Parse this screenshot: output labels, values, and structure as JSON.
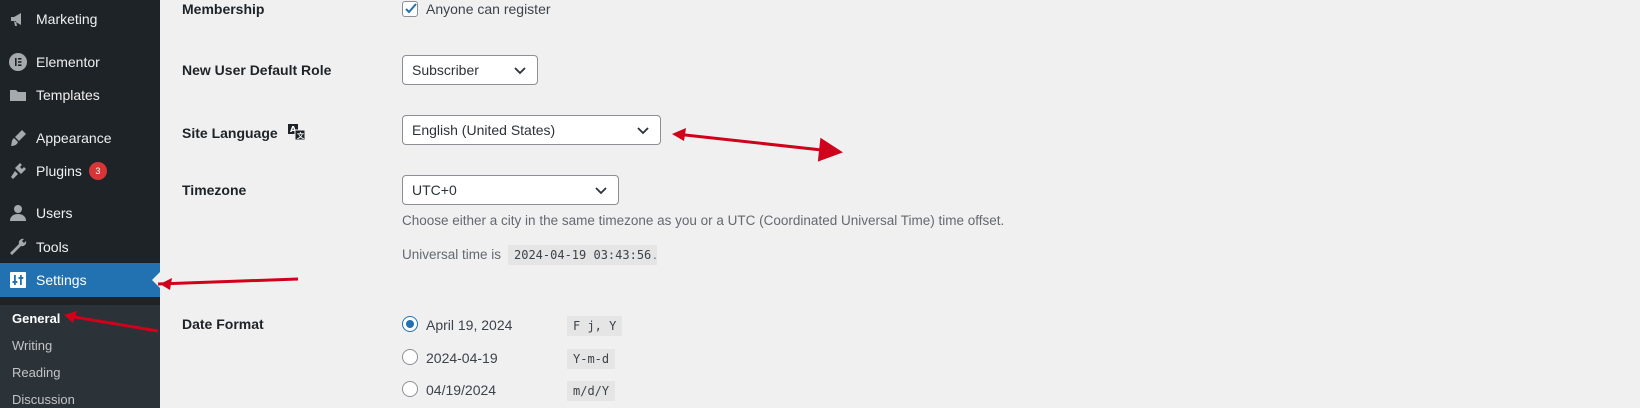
{
  "sidebar": {
    "items": [
      {
        "label": "Marketing",
        "icon": "megaphone-icon"
      },
      {
        "label": "Elementor",
        "icon": "elementor-icon"
      },
      {
        "label": "Templates",
        "icon": "folder-icon"
      },
      {
        "label": "Appearance",
        "icon": "brush-icon"
      },
      {
        "label": "Plugins",
        "icon": "plug-icon",
        "badge": "3"
      },
      {
        "label": "Users",
        "icon": "user-icon"
      },
      {
        "label": "Tools",
        "icon": "wrench-icon"
      },
      {
        "label": "Settings",
        "icon": "sliders-icon",
        "active": true
      }
    ],
    "submenu": [
      "General",
      "Writing",
      "Reading",
      "Discussion"
    ]
  },
  "settings": {
    "membership": {
      "label": "Membership",
      "checkbox_label": "Anyone can register",
      "checked": true
    },
    "default_role": {
      "label": "New User Default Role",
      "value": "Subscriber"
    },
    "site_language": {
      "label": "Site Language",
      "value": "English (United States)"
    },
    "timezone": {
      "label": "Timezone",
      "value": "UTC+0",
      "description": "Choose either a city in the same timezone as you or a UTC (Coordinated Universal Time) time offset.",
      "universal_prefix": "Universal time is",
      "universal_value": "2024-04-19 03:43:56",
      "universal_suffix": "."
    },
    "date_format": {
      "label": "Date Format",
      "options": [
        {
          "display": "April 19, 2024",
          "code": "F j, Y",
          "checked": true
        },
        {
          "display": "2024-04-19",
          "code": "Y-m-d",
          "checked": false
        },
        {
          "display": "04/19/2024",
          "code": "m/d/Y",
          "checked": false
        }
      ]
    }
  },
  "colors": {
    "active": "#2271b1",
    "sidebar": "#1d2327",
    "annotation": "#d0021b"
  }
}
